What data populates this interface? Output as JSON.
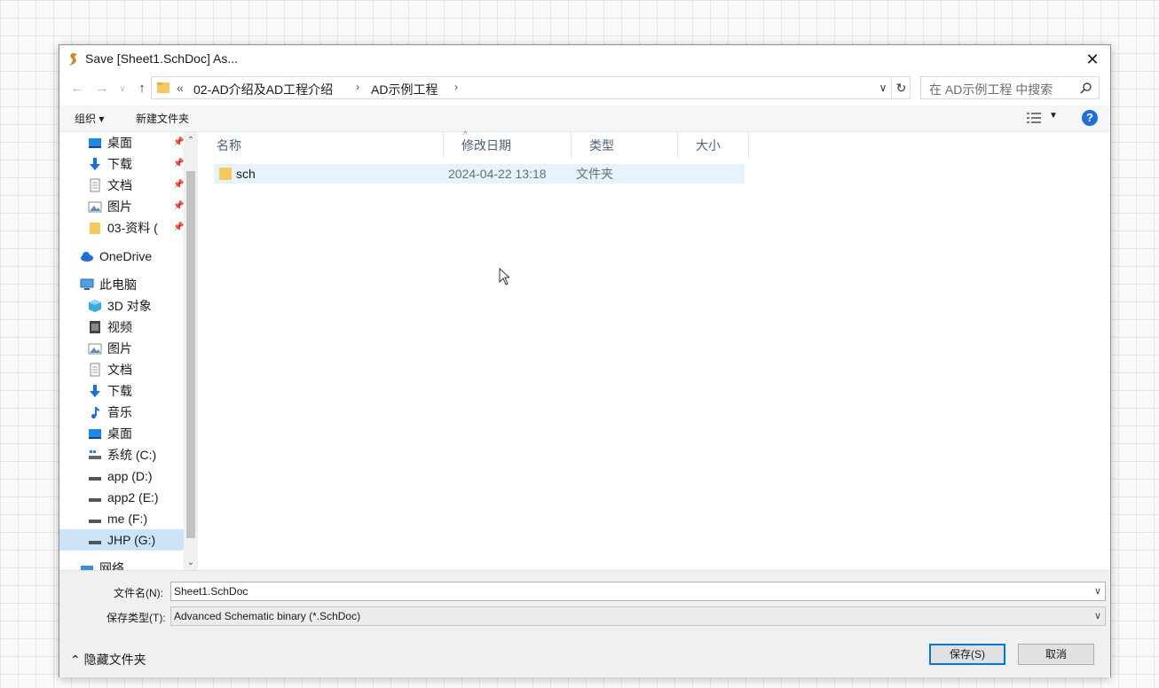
{
  "dialog": {
    "title": "Save [Sheet1.SchDoc] As...",
    "close_label": "✕"
  },
  "address": {
    "prefix": "«",
    "segments": [
      "02-AD介绍及AD工程介绍",
      "AD示例工程"
    ],
    "chevron": "›"
  },
  "search": {
    "placeholder": "在 AD示例工程 中搜索"
  },
  "toolbar": {
    "organize": "组织 ▾",
    "new_folder": "新建文件夹",
    "help": "?"
  },
  "nav": {
    "quick_access": [
      {
        "label": "桌面",
        "icon": "desktop-icon"
      },
      {
        "label": "下载",
        "icon": "download-icon"
      },
      {
        "label": "文档",
        "icon": "document-icon"
      },
      {
        "label": "图片",
        "icon": "picture-icon"
      },
      {
        "label": "03-资料  (",
        "icon": "folder-icon"
      }
    ],
    "onedrive": "OneDrive",
    "this_pc": "此电脑",
    "pc_items": [
      {
        "label": "3D 对象",
        "icon": "3d-objects-icon"
      },
      {
        "label": "视频",
        "icon": "video-icon"
      },
      {
        "label": "图片",
        "icon": "picture-icon"
      },
      {
        "label": "文档",
        "icon": "document-icon"
      },
      {
        "label": "下载",
        "icon": "download-icon"
      },
      {
        "label": "音乐",
        "icon": "music-icon"
      },
      {
        "label": "桌面",
        "icon": "desktop-icon"
      },
      {
        "label": "系统 (C:)",
        "icon": "system-drive-icon"
      },
      {
        "label": "app (D:)",
        "icon": "drive-icon"
      },
      {
        "label": "app2 (E:)",
        "icon": "drive-icon"
      },
      {
        "label": "me (F:)",
        "icon": "drive-icon"
      },
      {
        "label": "JHP (G:)",
        "icon": "drive-icon"
      }
    ],
    "network": "网络",
    "selected": "JHP (G:)"
  },
  "columns": [
    "名称",
    "修改日期",
    "类型",
    "大小"
  ],
  "files": [
    {
      "name": "sch",
      "modified": "2024-04-22 13:18",
      "type": "文件夹",
      "size": ""
    }
  ],
  "form": {
    "filename_label": "文件名(N):",
    "filename_value": "Sheet1.SchDoc",
    "filetype_label": "保存类型(T):",
    "filetype_value": "Advanced Schematic binary (*.SchDoc)"
  },
  "footer": {
    "hide_folders": "隐藏文件夹",
    "save": "保存(S)",
    "cancel": "取消"
  },
  "colors": {
    "accent": "#0078d7",
    "selection": "#cce4f7",
    "folder": "#f5c95e",
    "help": "#1e6fd9"
  }
}
